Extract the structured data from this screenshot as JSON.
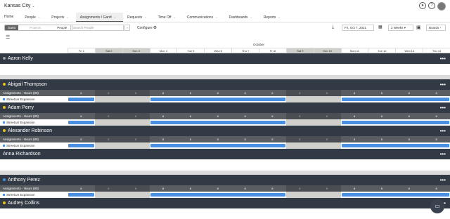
{
  "header": {
    "company": "Kansas City",
    "badge_count": "1"
  },
  "nav": {
    "items": [
      {
        "label": "Home",
        "has_menu": false
      },
      {
        "label": "People",
        "has_menu": true
      },
      {
        "label": "Projects",
        "has_menu": true
      },
      {
        "label": "Assignments / Gantt",
        "has_menu": true,
        "active": true
      },
      {
        "label": "Requests",
        "has_menu": true
      },
      {
        "label": "Time Off",
        "has_menu": true
      },
      {
        "label": "Communications",
        "has_menu": true
      },
      {
        "label": "Dashboards",
        "has_menu": true
      },
      {
        "label": "Reports",
        "has_menu": true
      }
    ]
  },
  "toolbar": {
    "view_toggle": [
      "Gantt",
      "Projects",
      "People"
    ],
    "search_placeholder": "Search People",
    "configure_label": "Configure",
    "date_value": "Fri, Oct 7, 2021",
    "range_value": "2 Weeks",
    "boards_label": "Boards"
  },
  "timeline": {
    "month": "October",
    "days": [
      {
        "label": "Fri 1",
        "weekend": false
      },
      {
        "label": "Sat 2",
        "weekend": true
      },
      {
        "label": "Sun 3",
        "weekend": true
      },
      {
        "label": "Mon 4",
        "weekend": false
      },
      {
        "label": "Tue 5",
        "weekend": false
      },
      {
        "label": "Wed 6",
        "weekend": false
      },
      {
        "label": "Thu 7",
        "weekend": false
      },
      {
        "label": "Fri 8",
        "weekend": false
      },
      {
        "label": "Sat 9",
        "weekend": true
      },
      {
        "label": "Sun 10",
        "weekend": true
      },
      {
        "label": "Mon 11",
        "weekend": false
      },
      {
        "label": "Tue 12",
        "weekend": false
      },
      {
        "label": "Wed 13",
        "weekend": false
      },
      {
        "label": "Thu 14",
        "weekend": false
      }
    ]
  },
  "people": [
    {
      "name": "Aaron Kelly",
      "dot": "#9e9e9e",
      "hours": null
    },
    {
      "name": "Abigail Thompson",
      "dot": "#e8c020",
      "hours_label": "Assignments - Hours (80)",
      "project": "Streetcar Expansion"
    },
    {
      "name": "Adam Perry",
      "dot": "#e8c020",
      "hours_label": "Assignments - Hours (80)",
      "project": "Streetcar Expansion"
    },
    {
      "name": "Alexander Robinson",
      "dot": "#e8c020",
      "hours_label": "Assignments - Hours (80)",
      "project": "Streetcar Expansion"
    },
    {
      "name": "Anna Richardson",
      "dot": null,
      "hours": null
    },
    {
      "name": "Anthony Perez",
      "dot": "#4a90d9",
      "hours_label": "Assignments - Hours (80)",
      "project": "Streetcar Expansion"
    },
    {
      "name": "Audrey Collins",
      "dot": "#e8c020",
      "hours": null
    }
  ],
  "hours_values": [
    "8",
    "0",
    "0",
    "8",
    "8",
    "8",
    "8",
    "8",
    "0",
    "0",
    "8",
    "8",
    "8",
    "8"
  ],
  "colors": {
    "header_bg": "#323a45",
    "bar": "#4a90e2",
    "weekend": "#cfcfcb"
  }
}
